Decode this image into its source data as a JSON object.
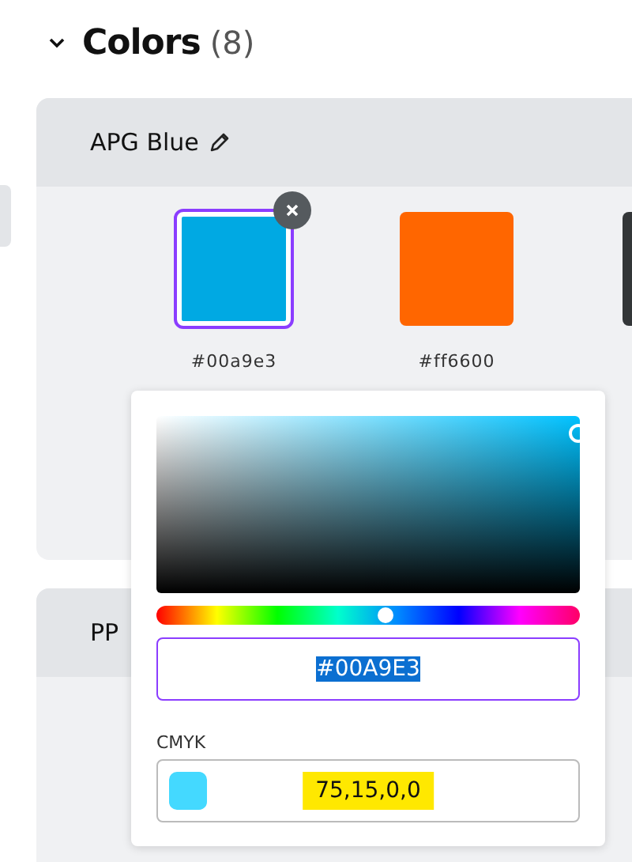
{
  "section": {
    "title": "Colors",
    "count": "(8)",
    "expanded": true
  },
  "palettes": [
    {
      "name": "APG Blue",
      "swatches": [
        {
          "color": "#00a9e3",
          "label": "#00a9e3",
          "selected": true
        },
        {
          "color": "#ff6600",
          "label": "#ff6600",
          "selected": false
        },
        {
          "color": "#333638",
          "selected": false
        }
      ]
    },
    {
      "name": "PP"
    }
  ],
  "picker": {
    "hue": {
      "level": 0.54
    },
    "hex": {
      "value": "#00A9E3",
      "text_selected": true
    },
    "cmyk_label": "CMYK",
    "cmyk": {
      "color": "#44d9ff",
      "value": "75,15,0,0",
      "highlighted": true
    }
  }
}
